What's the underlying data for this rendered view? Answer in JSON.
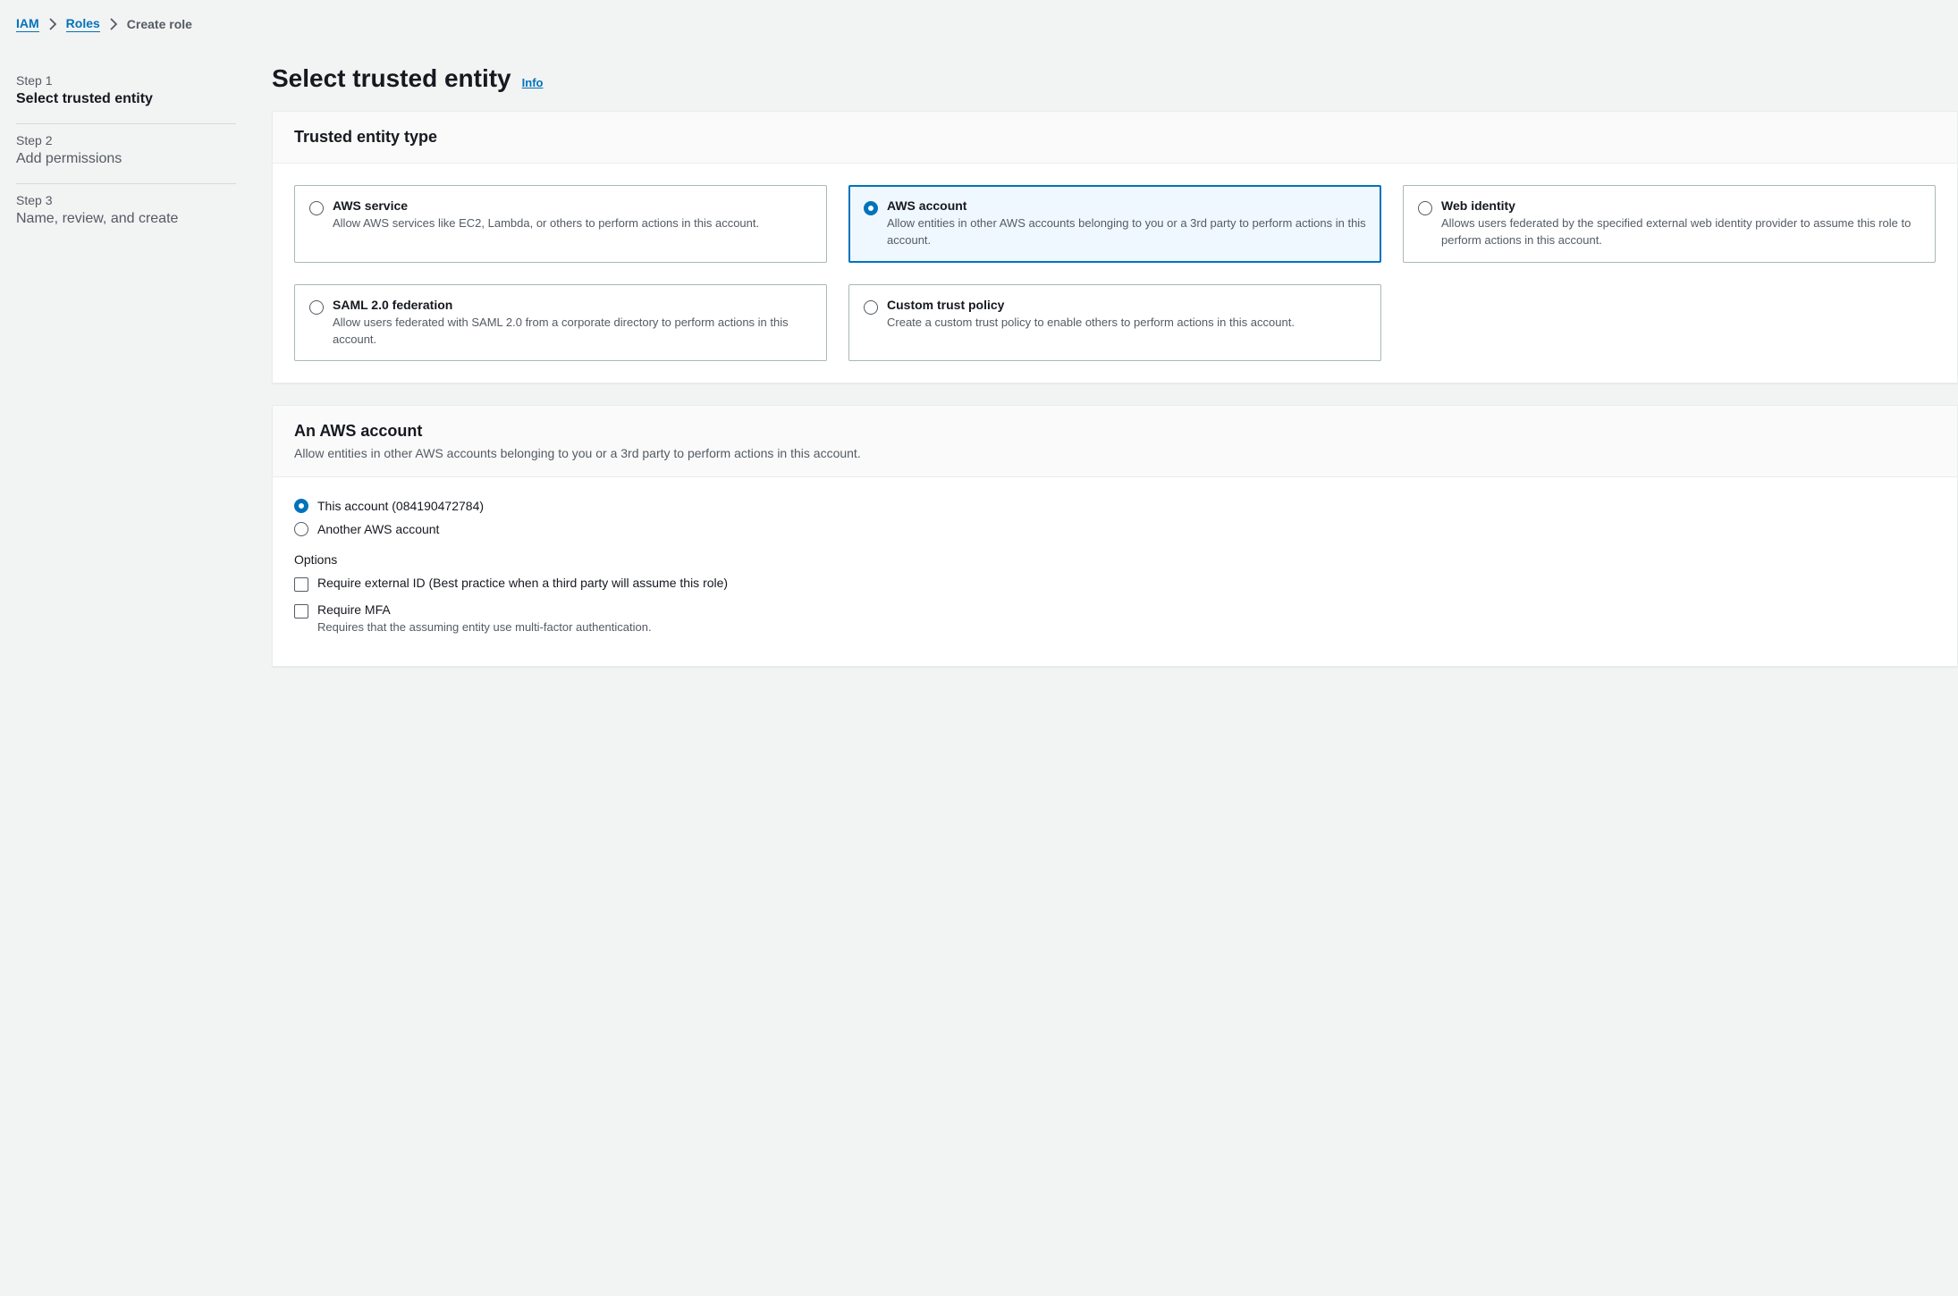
{
  "breadcrumb": {
    "items": [
      "IAM",
      "Roles",
      "Create role"
    ]
  },
  "steps": [
    {
      "num": "Step 1",
      "title": "Select trusted entity",
      "active": true
    },
    {
      "num": "Step 2",
      "title": "Add permissions",
      "active": false
    },
    {
      "num": "Step 3",
      "title": "Name, review, and create",
      "active": false
    }
  ],
  "page": {
    "title": "Select trusted entity",
    "info": "Info"
  },
  "trustedEntity": {
    "header": "Trusted entity type",
    "tiles": [
      {
        "title": "AWS service",
        "desc": "Allow AWS services like EC2, Lambda, or others to perform actions in this account.",
        "selected": false
      },
      {
        "title": "AWS account",
        "desc": "Allow entities in other AWS accounts belonging to you or a 3rd party to perform actions in this account.",
        "selected": true
      },
      {
        "title": "Web identity",
        "desc": "Allows users federated by the specified external web identity provider to assume this role to perform actions in this account.",
        "selected": false
      },
      {
        "title": "SAML 2.0 federation",
        "desc": "Allow users federated with SAML 2.0 from a corporate directory to perform actions in this account.",
        "selected": false
      },
      {
        "title": "Custom trust policy",
        "desc": "Create a custom trust policy to enable others to perform actions in this account.",
        "selected": false
      }
    ]
  },
  "account": {
    "header": "An AWS account",
    "sub": "Allow entities in other AWS accounts belonging to you or a 3rd party to perform actions in this account.",
    "radios": [
      {
        "label": "This account (084190472784)",
        "selected": true
      },
      {
        "label": "Another AWS account",
        "selected": false
      }
    ],
    "optionsLabel": "Options",
    "checkboxes": [
      {
        "label": "Require external ID (Best practice when a third party will assume this role)",
        "desc": "",
        "checked": false
      },
      {
        "label": "Require MFA",
        "desc": "Requires that the assuming entity use multi-factor authentication.",
        "checked": false
      }
    ]
  }
}
